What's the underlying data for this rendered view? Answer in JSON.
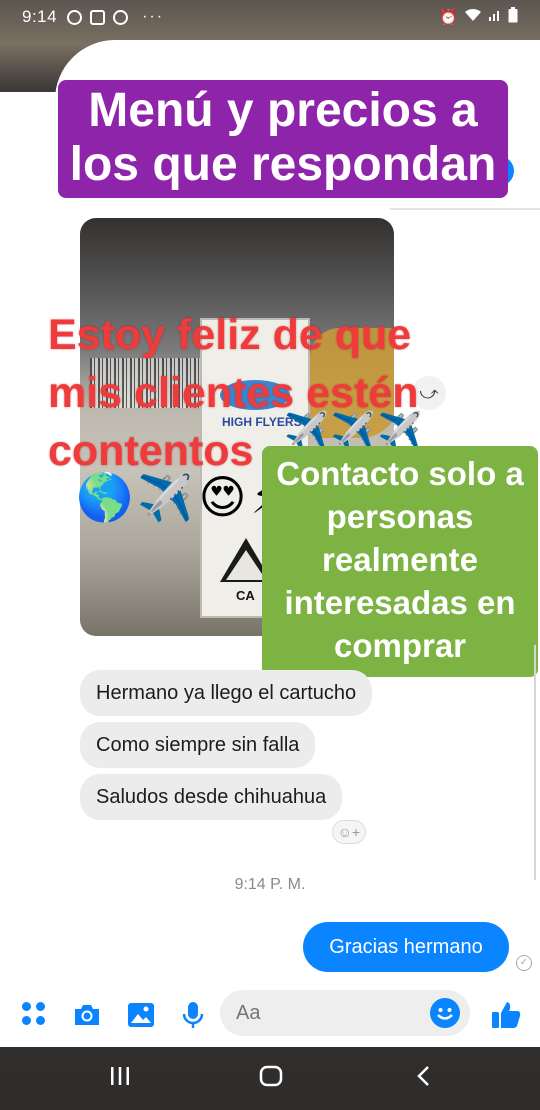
{
  "status_bar": {
    "time": "9:14",
    "dots": "···"
  },
  "header": {
    "video_icon": "video-camera-icon",
    "info_icon": "info-icon",
    "info_glyph": "i"
  },
  "overlay": {
    "purple_banner": "Menú y precios a los que respondan",
    "red_text": "Estoy feliz de que mis clientes  estén contentos",
    "planes": "✈️✈️✈️",
    "emojis": "🌎✈️😍⚡",
    "green_banner": "Contacto solo a personas realmente interesadas en comprar"
  },
  "photo": {
    "box_text": "HIGH FLYERS",
    "box_ca": "CA"
  },
  "messages": {
    "incoming": [
      "Hermano ya llego el cartucho",
      "Como siempre sin falla",
      "Saludos desde chihuahua"
    ],
    "reaction_label": "☺+",
    "timestamp": "9:14 P. M.",
    "outgoing": "Gracias hermano"
  },
  "composer": {
    "placeholder": "Aa"
  },
  "colors": {
    "messenger_blue": "#0a84ff",
    "purple_banner": "#8e24aa",
    "green_banner": "#7cb342",
    "red_text": "#ef3b3b"
  }
}
